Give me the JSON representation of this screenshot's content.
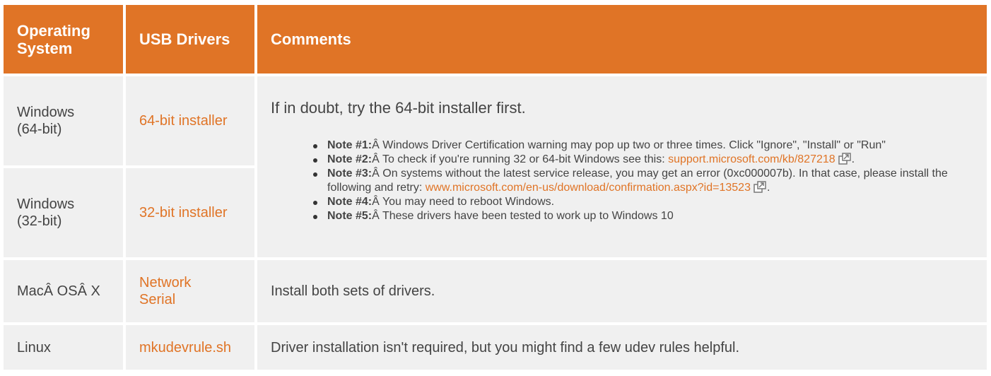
{
  "header": {
    "os": "Operating System",
    "drivers": "USB Drivers",
    "comments": "Comments"
  },
  "rows": {
    "win64": {
      "os": "Windows (64-bit)",
      "driver": "64-bit installer"
    },
    "win32": {
      "os": "Windows (32-bit)",
      "driver": "32-bit installer"
    },
    "mac": {
      "os": "MacÂ OSÂ X",
      "driver_1": "Network",
      "driver_2": "Serial",
      "comment": "Install both sets of drivers."
    },
    "linux": {
      "os": "Linux",
      "driver": "mkudevrule.sh",
      "comment": "Driver installation isn't required, but you might find a few udev rules helpful."
    }
  },
  "windows_comment": {
    "lead": "If in doubt, try the 64-bit installer first.",
    "notes": [
      {
        "label": "Note #1:",
        "text": "Â Windows Driver Certification warning may pop up two or three times. Click \"Ignore\", \"Install\" or \"Run\""
      },
      {
        "label": "Note #2:",
        "text": "Â To check if you're running 32 or 64-bit Windows see this: ",
        "link": "support.microsoft.com/kb/827218",
        "after": "."
      },
      {
        "label": "Note #3:",
        "text": "Â On systems without the latest service release, you may get an error (0xc000007b). In that case, please install the following and retry: ",
        "link": "www.microsoft.com/en-us/download/confirmation.aspx?id=13523",
        "after": "."
      },
      {
        "label": "Note #4:",
        "text": "Â You may need to reboot Windows."
      },
      {
        "label": "Note #5:",
        "text": "Â These drivers have been tested to work up to Windows 10"
      }
    ]
  },
  "colors": {
    "header_bg": "#e07426",
    "cell_bg": "#f0f0f0",
    "link": "#e07426"
  },
  "icons": {
    "external_link": "external-link-icon"
  }
}
